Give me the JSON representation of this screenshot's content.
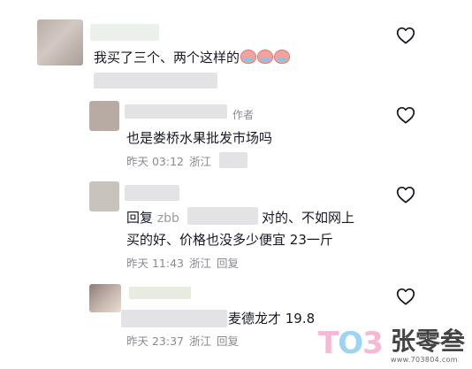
{
  "comments": [
    {
      "text": "我买了三个、两个这样的",
      "emoji_names": [
        "cry-laugh-emoji",
        "cry-laugh-emoji",
        "cry-laugh-emoji"
      ],
      "liked": false
    }
  ],
  "replies": [
    {
      "author_tag": "作者",
      "text": "也是娄桥水果批发市场吗",
      "time": "昨天 03:12",
      "location": "浙江",
      "liked": false
    },
    {
      "reply_prefix": "回复",
      "reply_to_visible": "zbb",
      "text_line1": "对的、不如网上",
      "text_line2": "买的好、价格也没多少便宜 23一斤",
      "time": "昨天 11:43",
      "location": "浙江",
      "action": "回复",
      "liked": false
    },
    {
      "text": "麦德龙才 19.8",
      "time": "昨天 23:37",
      "location": "浙江",
      "action": "回复",
      "liked": false
    }
  ],
  "icons": {
    "like": "heart-outline-icon"
  },
  "watermark": {
    "logo": "TO3",
    "name": "张零叁",
    "url": "www.703804.com"
  },
  "colors": {
    "text": "#161823",
    "meta": "#8a8b91",
    "heart": "#161823"
  }
}
